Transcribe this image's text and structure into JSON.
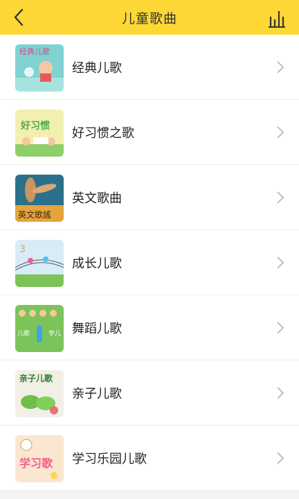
{
  "header": {
    "title": "儿童歌曲"
  },
  "items": [
    {
      "label": "经典儿歌",
      "thumb_icon": "classic-songs-cover"
    },
    {
      "label": "好习惯之歌",
      "thumb_icon": "good-habits-cover"
    },
    {
      "label": "英文歌曲",
      "thumb_icon": "english-songs-cover"
    },
    {
      "label": "成长儿歌",
      "thumb_icon": "growth-songs-cover"
    },
    {
      "label": "舞蹈儿歌",
      "thumb_icon": "dance-songs-cover"
    },
    {
      "label": "亲子儿歌",
      "thumb_icon": "parent-child-cover"
    },
    {
      "label": "学习乐园儿歌",
      "thumb_icon": "learning-park-cover"
    }
  ],
  "colors": {
    "header_bg": "#fdd835"
  }
}
